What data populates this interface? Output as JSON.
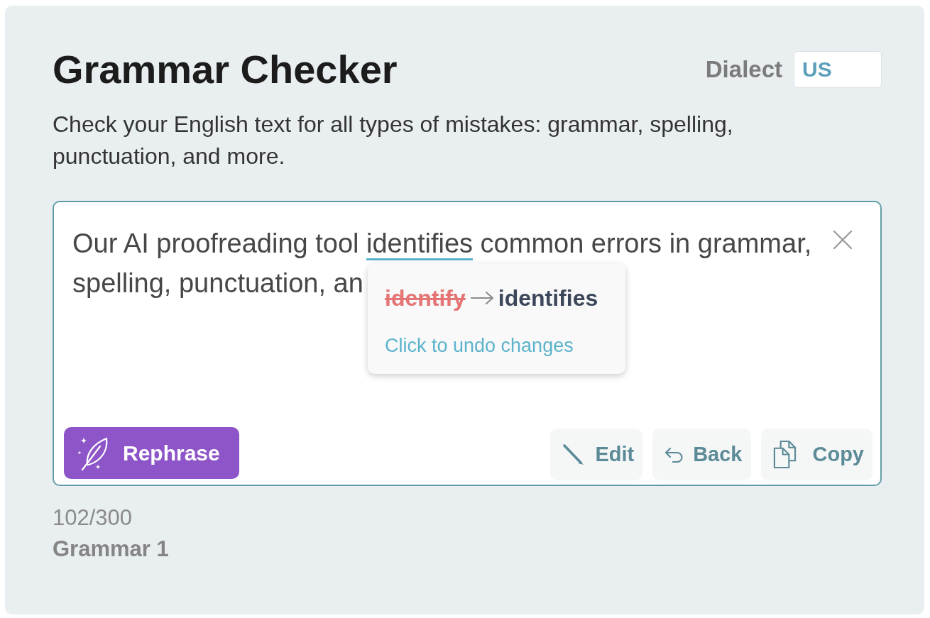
{
  "title": "Grammar Checker",
  "dialect": {
    "label": "Dialect",
    "value": "US"
  },
  "description": "Check your English text for all types of mistakes: grammar, spelling, punctuation, and more.",
  "editor": {
    "segments": [
      {
        "text": "Our AI proofreading tool",
        "corrected": false
      },
      {
        "text": "identifies",
        "corrected": true
      },
      {
        "text": "common errors in grammar,",
        "corrected": false
      },
      {
        "text": "spelling, punctuation, an",
        "corrected": false
      }
    ],
    "suggestion": {
      "original": "identify",
      "replacement": "identifies",
      "action": "Click to undo changes"
    },
    "rephrase_button": "Rephrase",
    "actions": [
      {
        "kind": "edit",
        "label": "Edit"
      },
      {
        "kind": "back",
        "label": "Back"
      },
      {
        "kind": "copy",
        "label": "Copy"
      }
    ]
  },
  "counter": "102/300",
  "tool_label": "Grammar 1"
}
